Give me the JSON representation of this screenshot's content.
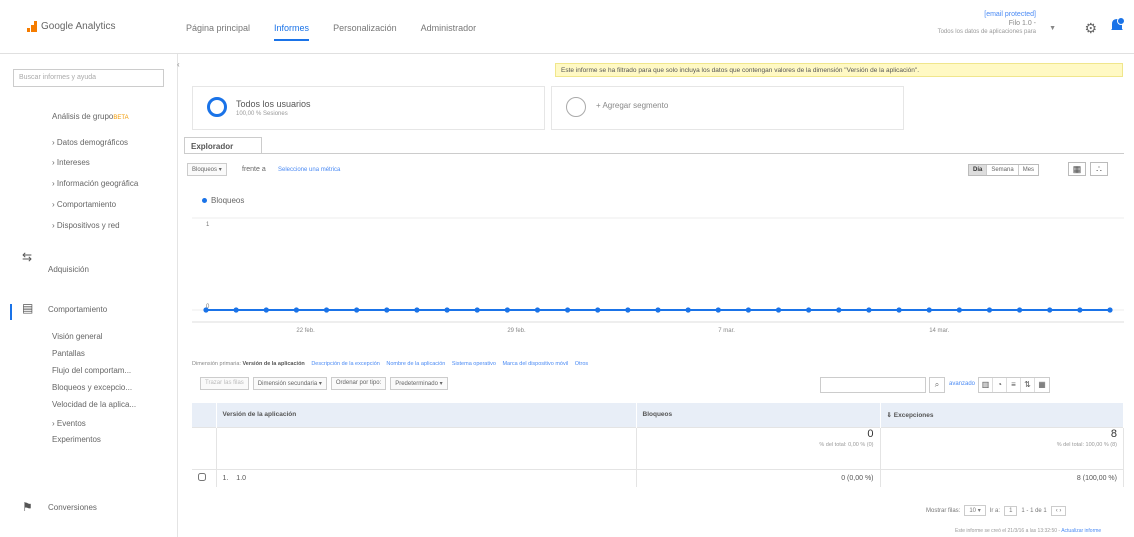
{
  "app": {
    "name": "Google Analytics"
  },
  "topnav": [
    {
      "label": "Página principal",
      "active": false
    },
    {
      "label": "Informes",
      "active": true
    },
    {
      "label": "Personalización",
      "active": false
    },
    {
      "label": "Administrador",
      "active": false
    }
  ],
  "account": {
    "email": "[email protected]",
    "property": "Filo 1.0 -",
    "desc": "Todos los datos de aplicaciones para"
  },
  "sidebar": {
    "search_placeholder": "Buscar informes y ayuda",
    "audience_items": [
      {
        "label": "Análisis de grupo",
        "badge": "BETA"
      },
      {
        "label": "› Datos demográficos"
      },
      {
        "label": "› Intereses"
      },
      {
        "label": "› Información geográfica"
      },
      {
        "label": "› Comportamiento"
      },
      {
        "label": "› Dispositivos y red"
      }
    ],
    "acquisition": "Adquisición",
    "behavior": "Comportamiento",
    "behavior_items": [
      {
        "label": "Visión general"
      },
      {
        "label": "Pantallas"
      },
      {
        "label": "Flujo del comportam..."
      },
      {
        "label": "Bloqueos y excepcio..."
      },
      {
        "label": "Velocidad de la aplica..."
      },
      {
        "label": "› Eventos"
      },
      {
        "label": "Experimentos"
      }
    ],
    "conversions": "Conversiones"
  },
  "banner": "Este informe se ha filtrado para que solo incluya los datos que contengan valores de la dimensión \"Versión de la aplicación\".",
  "segments": {
    "all_users": "Todos los usuarios",
    "all_users_pct": "100,00 % Sesiones",
    "add_segment": "+ Agregar segmento"
  },
  "explorer_tab": "Explorador",
  "metric": {
    "selected": "Bloqueos",
    "vs": "frente a",
    "select_metric": "Seleccione una métrica"
  },
  "periods": [
    {
      "label": "Día",
      "active": true
    },
    {
      "label": "Semana",
      "active": false
    },
    {
      "label": "Mes",
      "active": false
    }
  ],
  "chart_data": {
    "type": "line",
    "series": [
      {
        "name": "Bloqueos",
        "values": [
          0,
          0,
          0,
          0,
          0,
          0,
          0,
          0,
          0,
          0,
          0,
          0,
          0,
          0,
          0,
          0,
          0,
          0,
          0,
          0,
          0,
          0,
          0,
          0,
          0,
          0,
          0,
          0,
          0,
          0,
          0
        ]
      }
    ],
    "x_tick_labels": [
      "22 feb.",
      "29 feb.",
      "7 mar.",
      "14 mar."
    ],
    "x_tick_index": [
      3,
      10,
      17,
      24
    ],
    "y_tick_labels": [
      "1",
      "0"
    ],
    "ylim": [
      0,
      1
    ],
    "color": "#1a73e8"
  },
  "primary_dimension": {
    "label": "Dimensión primaria:",
    "selected": "Versión de la aplicación",
    "others": [
      "Descripción de la excepción",
      "Nombre de la aplicación",
      "Sistema operativo",
      "Marca del dispositivo móvil",
      "Otros"
    ]
  },
  "controls": {
    "plot_rows": "Trazar las filas",
    "secondary_dimension": "Dimensión secundaria",
    "sort_type": "Ordenar por tipo:",
    "default": "Predeterminado"
  },
  "table_search": {
    "advanced": "avanzado"
  },
  "table": {
    "headers": [
      "Versión de la aplicación",
      "Bloqueos",
      "Excepciones"
    ],
    "totals": {
      "crashes": "0",
      "crashes_sub": "% del total: 0,00 % (0)",
      "exceptions": "8",
      "exceptions_sub": "% del total: 100,00 % (8)"
    },
    "rows": [
      {
        "index": "1.",
        "version": "1.0",
        "crashes": "0 (0,00 %)",
        "exceptions": "8 (100,00 %)"
      }
    ]
  },
  "pager": {
    "show_rows": "Mostrar filas:",
    "rows": "10",
    "goto": "Ir a:",
    "page": "1",
    "range": "1 - 1 de 1"
  },
  "footer": {
    "note": "Este informe se creó el 21/3/16 a las 13:32:50 - ",
    "refresh": "Actualizar informe"
  }
}
